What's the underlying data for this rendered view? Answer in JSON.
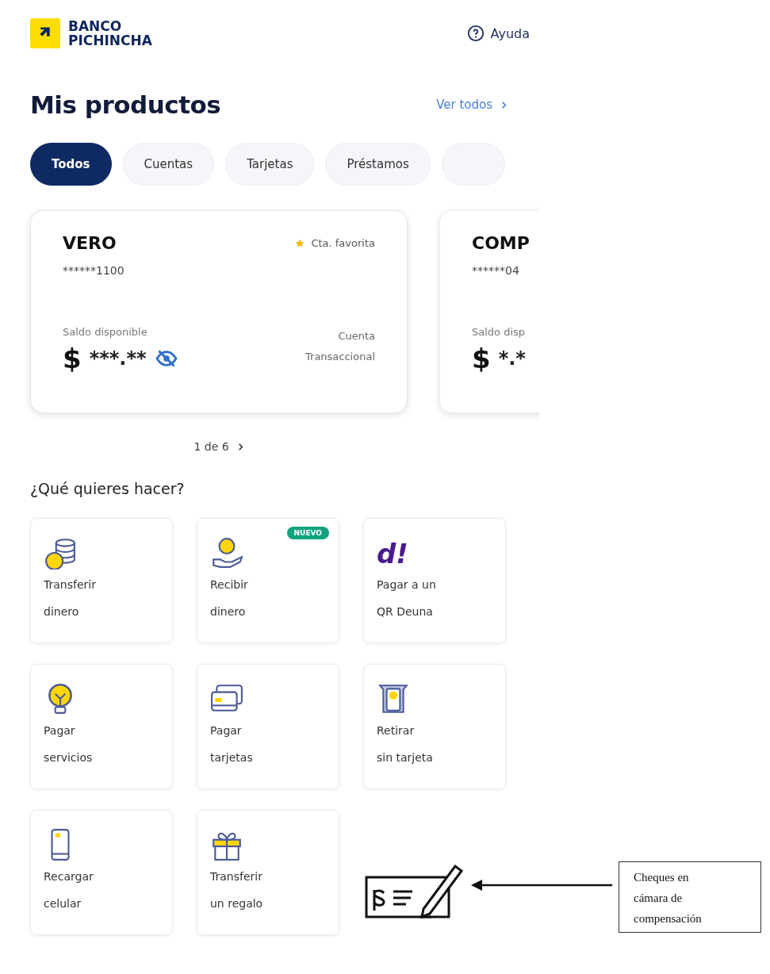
{
  "header": {
    "logo_lines": [
      "BANCO",
      "PICHINCHA"
    ],
    "help": "Ayuda"
  },
  "products": {
    "title": "Mis productos",
    "see_all": "Ver todos",
    "filters": [
      {
        "kind": "pill",
        "label": "Todos",
        "selected": true
      },
      {
        "kind": "pill",
        "label": "Cuentas",
        "selected": false
      },
      {
        "kind": "pill",
        "label": "Tarjetas",
        "selected": false
      },
      {
        "kind": "pill",
        "label": "Préstamos",
        "selected": false
      },
      {
        "kind": "cut",
        "selected": false
      }
    ],
    "cards": [
      {
        "name": "VERO",
        "number": "******1100",
        "favorite": true,
        "favorite_label": "Cta. favorita",
        "balance_label": "Saldo disponible",
        "currency": "$",
        "balance": "***.**",
        "hidden_icon": true,
        "type_lines": [
          "Cuenta",
          "Transaccional"
        ]
      },
      {
        "name": "COMP",
        "number": "******04",
        "favorite": false,
        "balance_label": "Saldo disp",
        "currency": "$",
        "balance": "*.*",
        "hidden_icon": false
      }
    ],
    "pager": "1 de 6"
  },
  "actions": {
    "title": "¿Qué quieres hacer?",
    "items": [
      {
        "kind": "coins",
        "lines": [
          "Transferir",
          "dinero"
        ]
      },
      {
        "kind": "hand",
        "lines": [
          "Recibir",
          "dinero"
        ],
        "badge": "NUEVO"
      },
      {
        "kind": "deuna",
        "logo": "d!",
        "lines": [
          "Pagar a un",
          "QR Deuna"
        ]
      },
      {
        "kind": "bulb",
        "lines": [
          "Pagar",
          "servicios"
        ]
      },
      {
        "kind": "cards",
        "lines": [
          "Pagar",
          "tarjetas"
        ]
      },
      {
        "kind": "atm",
        "lines": [
          "Retirar",
          "sin tarjeta"
        ]
      },
      {
        "kind": "phone",
        "lines": [
          "Recargar",
          "celular"
        ]
      },
      {
        "kind": "gift",
        "lines": [
          "Transferir",
          "un regalo"
        ]
      }
    ]
  },
  "annotation": {
    "lines": [
      "Cheques en",
      "cámara de",
      "compensación"
    ]
  }
}
